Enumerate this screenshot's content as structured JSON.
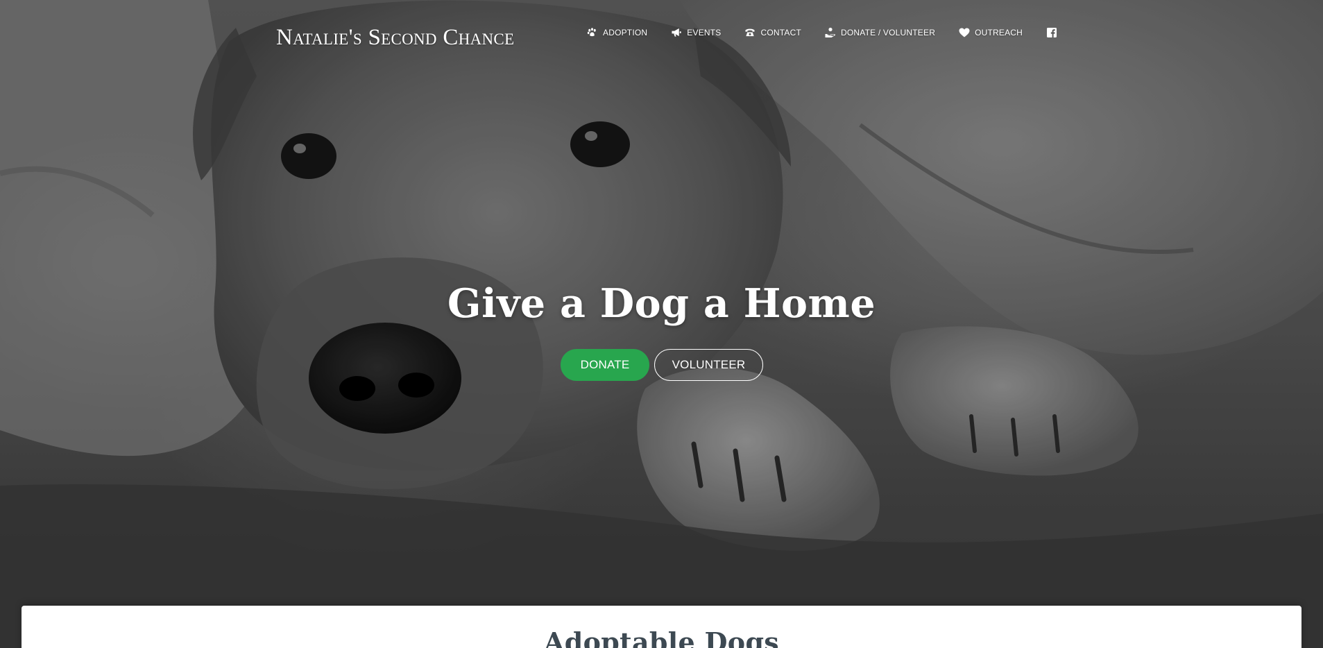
{
  "brand": {
    "name": "Natalie's Second Chance"
  },
  "nav": {
    "items": [
      {
        "label": "ADOPTION",
        "icon": "paw-icon"
      },
      {
        "label": "EVENTS",
        "icon": "megaphone-icon"
      },
      {
        "label": "CONTACT",
        "icon": "phone-icon"
      },
      {
        "label": "DONATE / VOLUNTEER",
        "icon": "helping-hand-icon"
      },
      {
        "label": "OUTREACH",
        "icon": "heart-icon"
      }
    ],
    "social_icon": "facebook-icon"
  },
  "hero": {
    "headline": "Give a Dog a Home",
    "donate_label": "DONATE",
    "volunteer_label": "VOLUNTEER",
    "background": "black-and-white photo of a dog resting its head on its paws under a blanket"
  },
  "section": {
    "title": "Adoptable Dogs"
  },
  "colors": {
    "donate_button": "#28a64e",
    "section_title": "#3d4952",
    "nav_text": "#ffffff"
  }
}
